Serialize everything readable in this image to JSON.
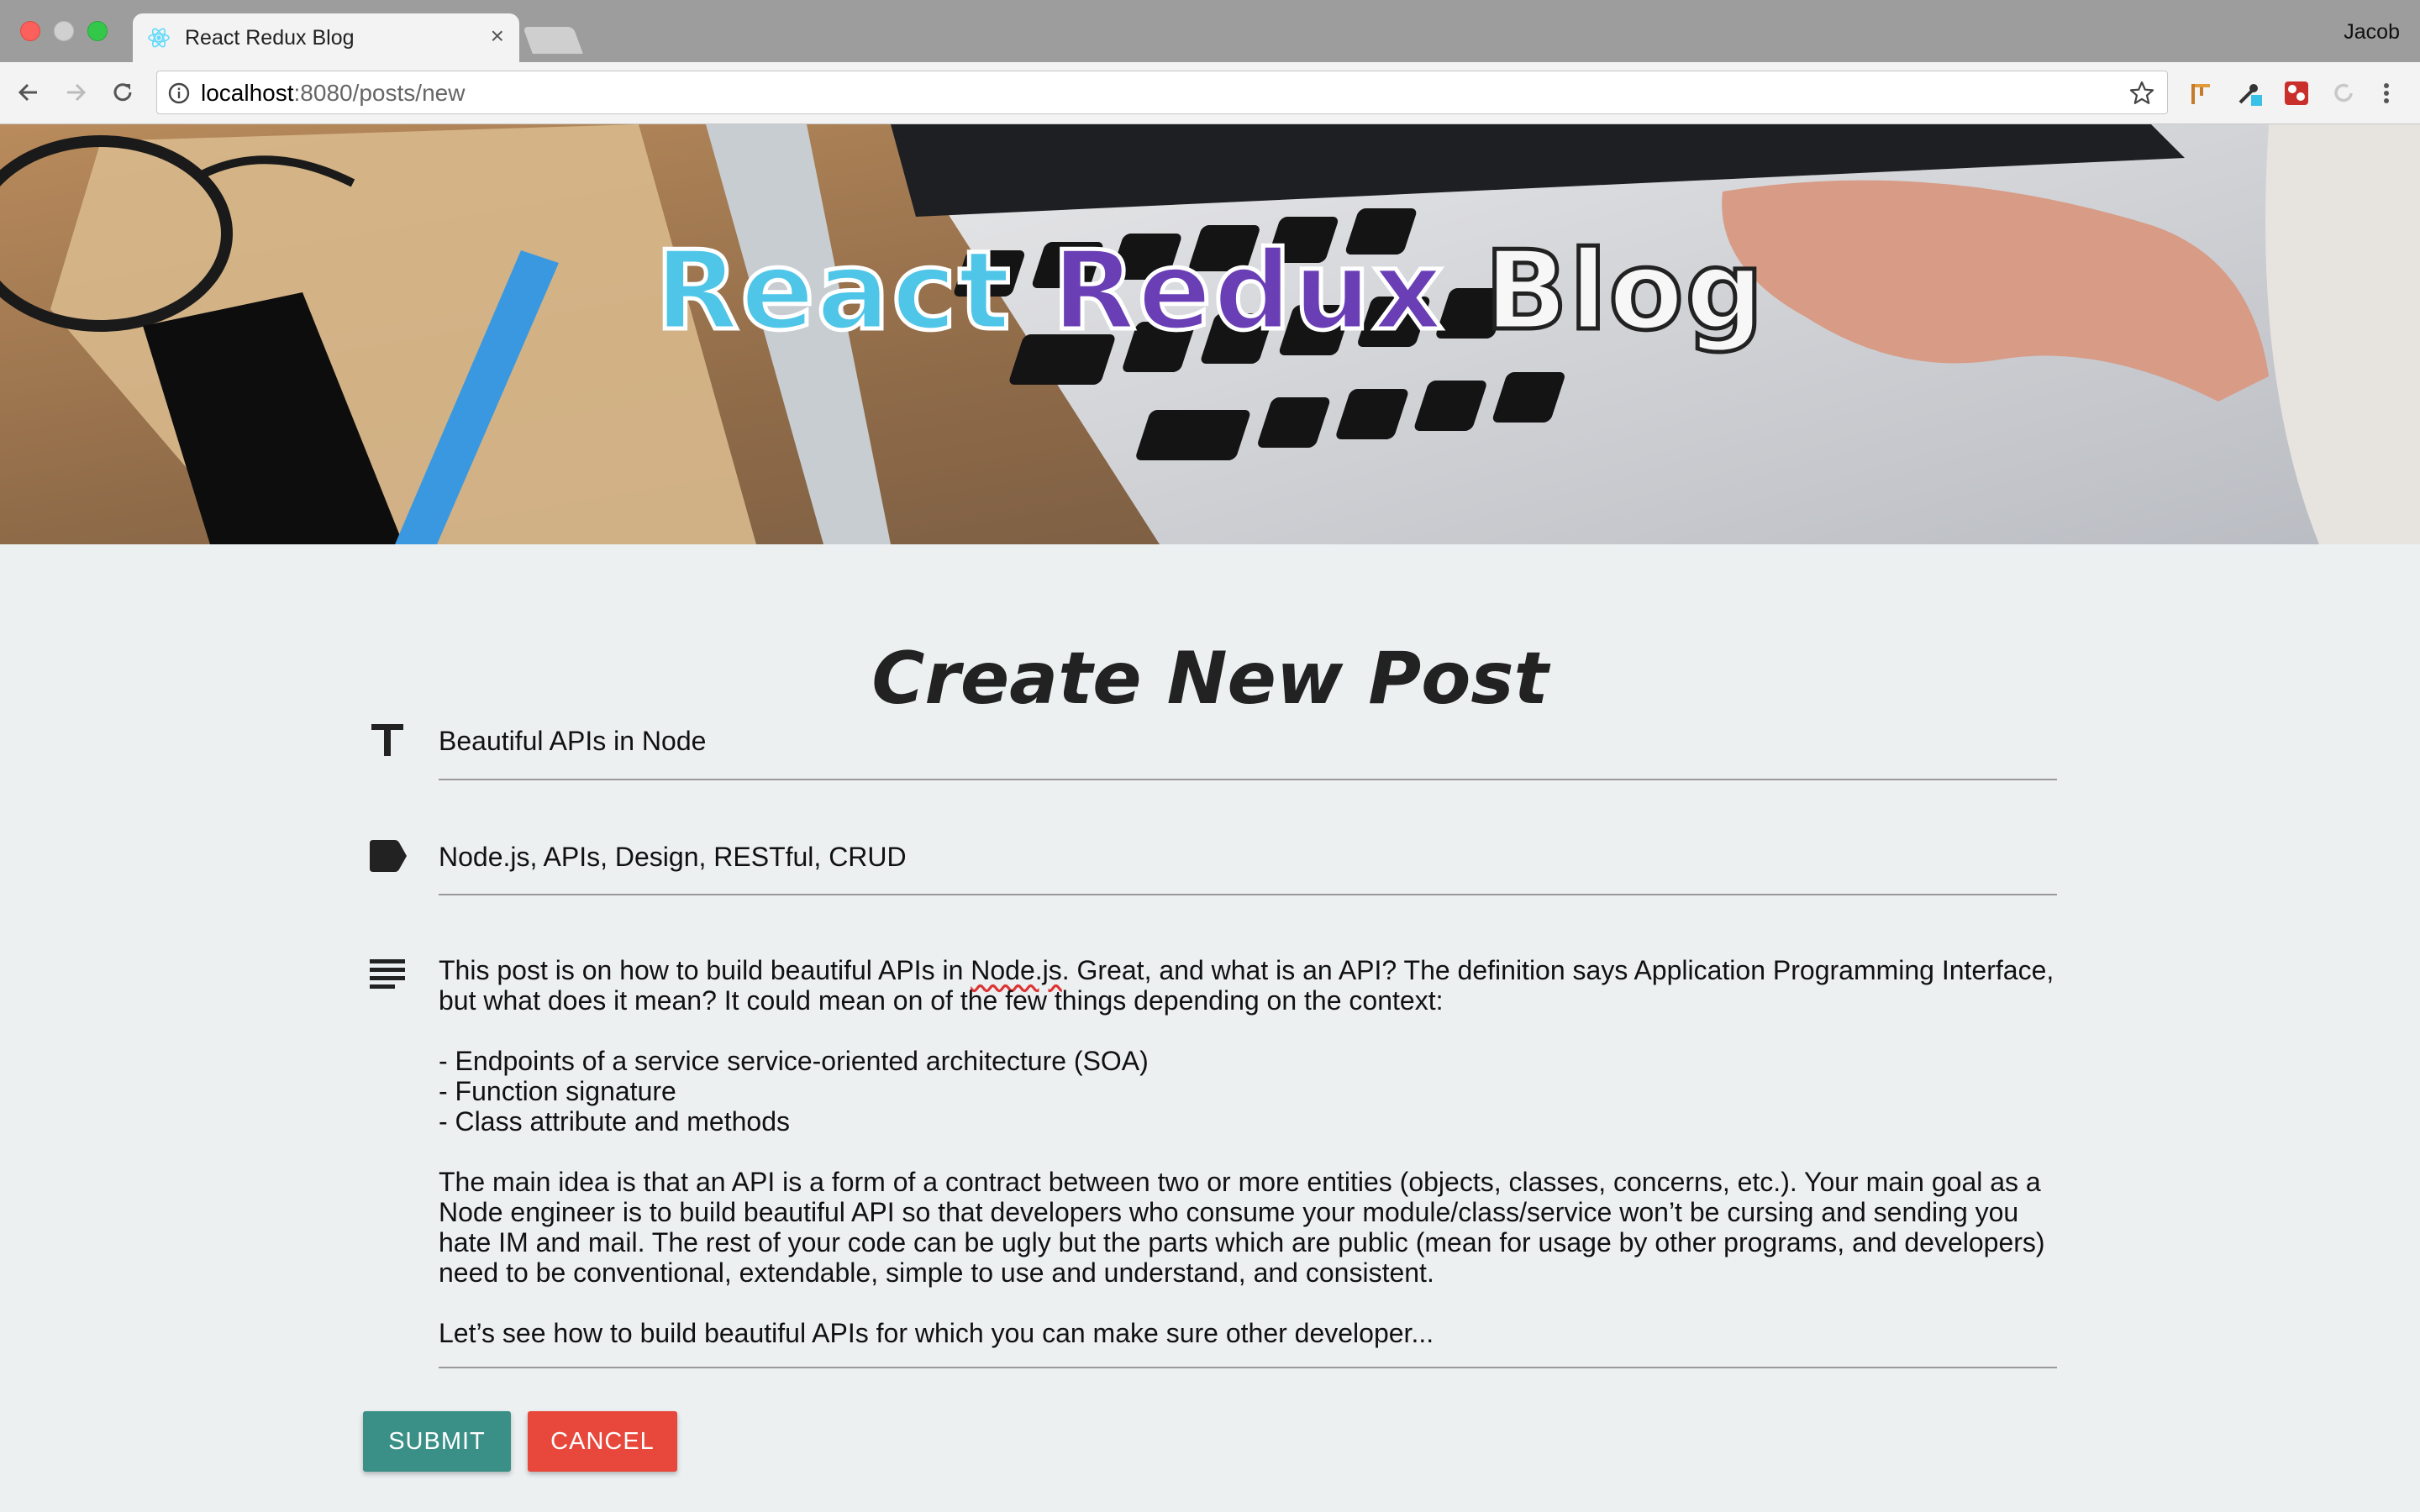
{
  "browser": {
    "tab_title": "React Redux Blog",
    "tab_close": "×",
    "profile_name": "Jacob",
    "url_host": "localhost",
    "url_path": ":8080/posts/new"
  },
  "hero": {
    "title_word1": "React",
    "title_word2": "Redux",
    "title_word3": "Blog",
    "colors": {
      "react": "#4fc6e8",
      "redux": "#6a3fb5",
      "blog": "#f7f7f7"
    }
  },
  "form": {
    "heading": "Create New Post",
    "title_value": "Beautiful APIs in Node",
    "categories_value": "Node.js, APIs, Design, RESTful, CRUD",
    "content": {
      "p1_before": "This post is on how to build beautiful APIs in ",
      "p1_misspelled": "Node.js",
      "p1_after": ". Great, and what is an API? The definition says Application Programming Interface, but what does it mean? It could mean on of the few things depending on the context:",
      "bullets": [
        "- Endpoints of a service service-oriented architecture (SOA)",
        "- Function signature",
        "- Class attribute and methods"
      ],
      "p2": "The main idea is that an API is a form of a contract between two or more entities (objects, classes, concerns, etc.). Your main goal as a Node engineer is to build beautiful API so that developers who consume your module/class/service won’t be cursing and sending you hate IM and mail. The rest of your code can be ugly but the parts which are public (mean for usage by other programs, and developers) need to be conventional, extendable, simple to use and understand, and consistent.",
      "p3": "Let’s see how to build beautiful APIs for which you can make sure other developer..."
    },
    "icons": {
      "title": "title-icon",
      "categories": "label-icon",
      "content": "notes-icon"
    },
    "submit_label": "SUBMIT",
    "cancel_label": "CANCEL",
    "colors": {
      "submit": "#3a8f87",
      "cancel": "#e8473b"
    }
  }
}
